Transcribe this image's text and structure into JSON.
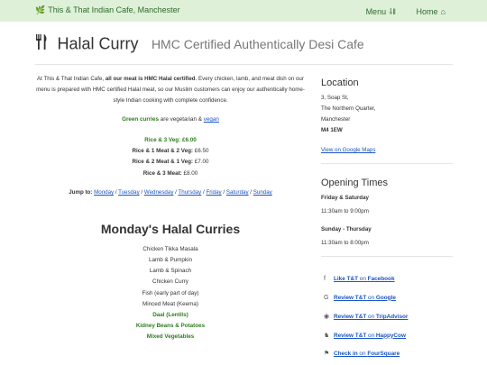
{
  "navbar": {
    "brand": "This & That Indian Cafe, Manchester",
    "menu_label": "Menu",
    "home_label": "Home"
  },
  "header": {
    "title": "Halal Curry",
    "subtitle": "HMC Certified Authentically Desi Cafe"
  },
  "intro": {
    "text_a": "At This & That Indian Cafe, ",
    "text_bold": "all our meat is HMC Halal certified",
    "text_b": ". Every chicken, lamb, and meat dish on our menu is prepared with HMC certified Halal meat, so our Muslim customers can enjoy our authentically home-style Indian cooking with complete confidence."
  },
  "legend": {
    "green_label": "Green curries",
    "middle": " are vegetarian & ",
    "vegan_label": "vegan"
  },
  "prices": [
    {
      "label": "Rice & 3 Veg:",
      "price": "£6.00",
      "veg": true
    },
    {
      "label": "Rice & 1 Meat & 2 Veg:",
      "price": "£6.50",
      "veg": false
    },
    {
      "label": "Rice & 2 Meat & 1 Veg:",
      "price": "£7.00",
      "veg": false
    },
    {
      "label": "Rice & 3 Meat:",
      "price": "£8.00",
      "veg": false
    }
  ],
  "jump": {
    "label": "Jump to:",
    "days": [
      "Monday",
      "Tuesday",
      "Wednesday",
      "Thursday",
      "Friday",
      "Saturday",
      "Sunday"
    ]
  },
  "monday": {
    "title": "Monday's Halal Curries",
    "curries": [
      {
        "name": "Chicken Tikka Masala",
        "veg": false
      },
      {
        "name": "Lamb & Pumpkin",
        "veg": false
      },
      {
        "name": "Lamb & Spinach",
        "veg": false
      },
      {
        "name": "Chicken Curry",
        "veg": false
      },
      {
        "name": "Fish (early part of day)",
        "veg": false
      },
      {
        "name": "Minced Meat (Keema)",
        "veg": false
      },
      {
        "name": "Daal (Lentils)",
        "veg": true
      },
      {
        "name": "Kidney Beans & Potatoes",
        "veg": true
      },
      {
        "name": "Mixed Vegetables",
        "veg": true
      }
    ]
  },
  "location": {
    "title": "Location",
    "line1": "3, Soap St,",
    "line2": "The Northern Quarter,",
    "line3": "Manchester",
    "postcode": "M4 1EW",
    "map_link": "View on Google Maps"
  },
  "opening": {
    "title": "Opening Times",
    "group1_days": "Friday & Saturday",
    "group1_hours": "11:30am to 9:00pm",
    "group2_days": "Sunday - Thursday",
    "group2_hours": "11:30am to 8:00pm"
  },
  "reviews": [
    {
      "icon": "facebook-icon",
      "glyph": "f",
      "link": "Like T&T",
      "on": " on ",
      "site": "Facebook"
    },
    {
      "icon": "google-icon",
      "glyph": "G",
      "link": "Review T&T",
      "on": " on ",
      "site": "Google"
    },
    {
      "icon": "tripadvisor-icon",
      "glyph": "◉",
      "link": "Review T&T",
      "on": " on ",
      "site": "TripAdvisor"
    },
    {
      "icon": "happycow-icon",
      "glyph": "♞",
      "link": "Review T&T",
      "on": " on ",
      "site": "HappyCow"
    },
    {
      "icon": "foursquare-icon",
      "glyph": "⚑",
      "link": "Check in",
      "on": " on ",
      "site": "FourSquare"
    }
  ],
  "colors": {
    "navbar_bg": "#dff0d8",
    "veg_green": "#2e7d1e",
    "link_blue": "#1a55c4"
  }
}
